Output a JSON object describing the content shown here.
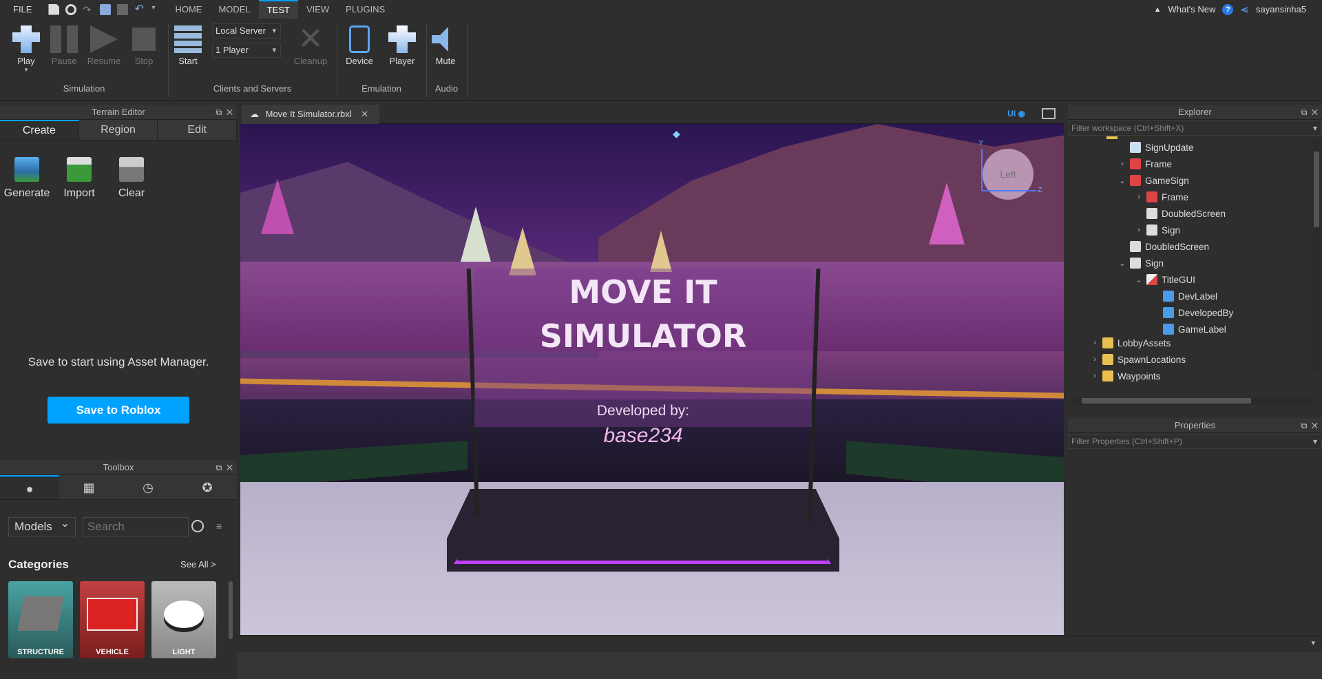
{
  "menu": {
    "file": "FILE"
  },
  "tabs": [
    "HOME",
    "MODEL",
    "TEST",
    "VIEW",
    "PLUGINS"
  ],
  "active_tab": "TEST",
  "top_right": {
    "whats_new": "What's New",
    "username": "sayansinha5"
  },
  "ribbon": {
    "buttons": {
      "play": "Play",
      "pause": "Pause",
      "resume": "Resume",
      "stop": "Stop",
      "start": "Start",
      "cleanup": "Cleanup",
      "device": "Device",
      "player": "Player",
      "mute": "Mute"
    },
    "server_select": "Local Server",
    "player_count_select": "1 Player",
    "groups": [
      "Simulation",
      "Clients and Servers",
      "Emulation",
      "Audio"
    ]
  },
  "terrain_editor": {
    "title": "Terrain Editor",
    "tabs": [
      "Create",
      "Region",
      "Edit"
    ],
    "tools": [
      "Generate",
      "Import",
      "Clear"
    ],
    "message": "Save to start using Asset Manager.",
    "save_button": "Save to Roblox"
  },
  "toolbox": {
    "title": "Toolbox",
    "category_select": "Models",
    "search_placeholder": "Search",
    "categories_title": "Categories",
    "see_all": "See All >",
    "categories": [
      "STRUCTURE",
      "VEHICLE",
      "LIGHT"
    ]
  },
  "document": {
    "tab_title": "Move It Simulator.rbxl",
    "ui_toggle": "UI",
    "view_cube_label": "Left",
    "axis_y": "Y",
    "axis_z": "Z",
    "sign": {
      "title_line1": "MOVE IT",
      "title_line2": "SIMULATOR",
      "developed_by": "Developed by:",
      "developer": "base234"
    }
  },
  "explorer": {
    "title": "Explorer",
    "filter_placeholder": "Filter workspace (Ctrl+Shift+X)",
    "items": [
      {
        "label": "SignUpdate",
        "icon": "script-icon",
        "arrow": ""
      },
      {
        "label": "Frame",
        "icon": "model-icon",
        "arrow": "›"
      },
      {
        "label": "GameSign",
        "icon": "model-icon",
        "arrow": "⌄"
      },
      {
        "label": "Frame",
        "icon": "model-icon",
        "arrow": "›"
      },
      {
        "label": "DoubledScreen",
        "icon": "part-icon",
        "arrow": ""
      },
      {
        "label": "Sign",
        "icon": "part-icon",
        "arrow": "›"
      },
      {
        "label": "DoubledScreen",
        "icon": "part-icon",
        "arrow": ""
      },
      {
        "label": "Sign",
        "icon": "part-icon",
        "arrow": "⌄"
      },
      {
        "label": "TitleGUI",
        "icon": "gui-icon",
        "arrow": "⌄"
      },
      {
        "label": "DevLabel",
        "icon": "textlabel-icon",
        "arrow": ""
      },
      {
        "label": "DevelopedBy",
        "icon": "textlabel-icon",
        "arrow": ""
      },
      {
        "label": "GameLabel",
        "icon": "textlabel-icon",
        "arrow": ""
      },
      {
        "label": "LobbyAssets",
        "icon": "folder-icon",
        "arrow": "›"
      },
      {
        "label": "SpawnLocations",
        "icon": "folder-icon",
        "arrow": "›"
      },
      {
        "label": "Waypoints",
        "icon": "folder-icon",
        "arrow": "›"
      }
    ]
  },
  "properties": {
    "title": "Properties",
    "filter_placeholder": "Filter Properties (Ctrl+Shift+P)"
  },
  "colors": {
    "accent": "#00a2ff",
    "panel": "#2e2e2e",
    "sign_neon": "#c040ff"
  }
}
